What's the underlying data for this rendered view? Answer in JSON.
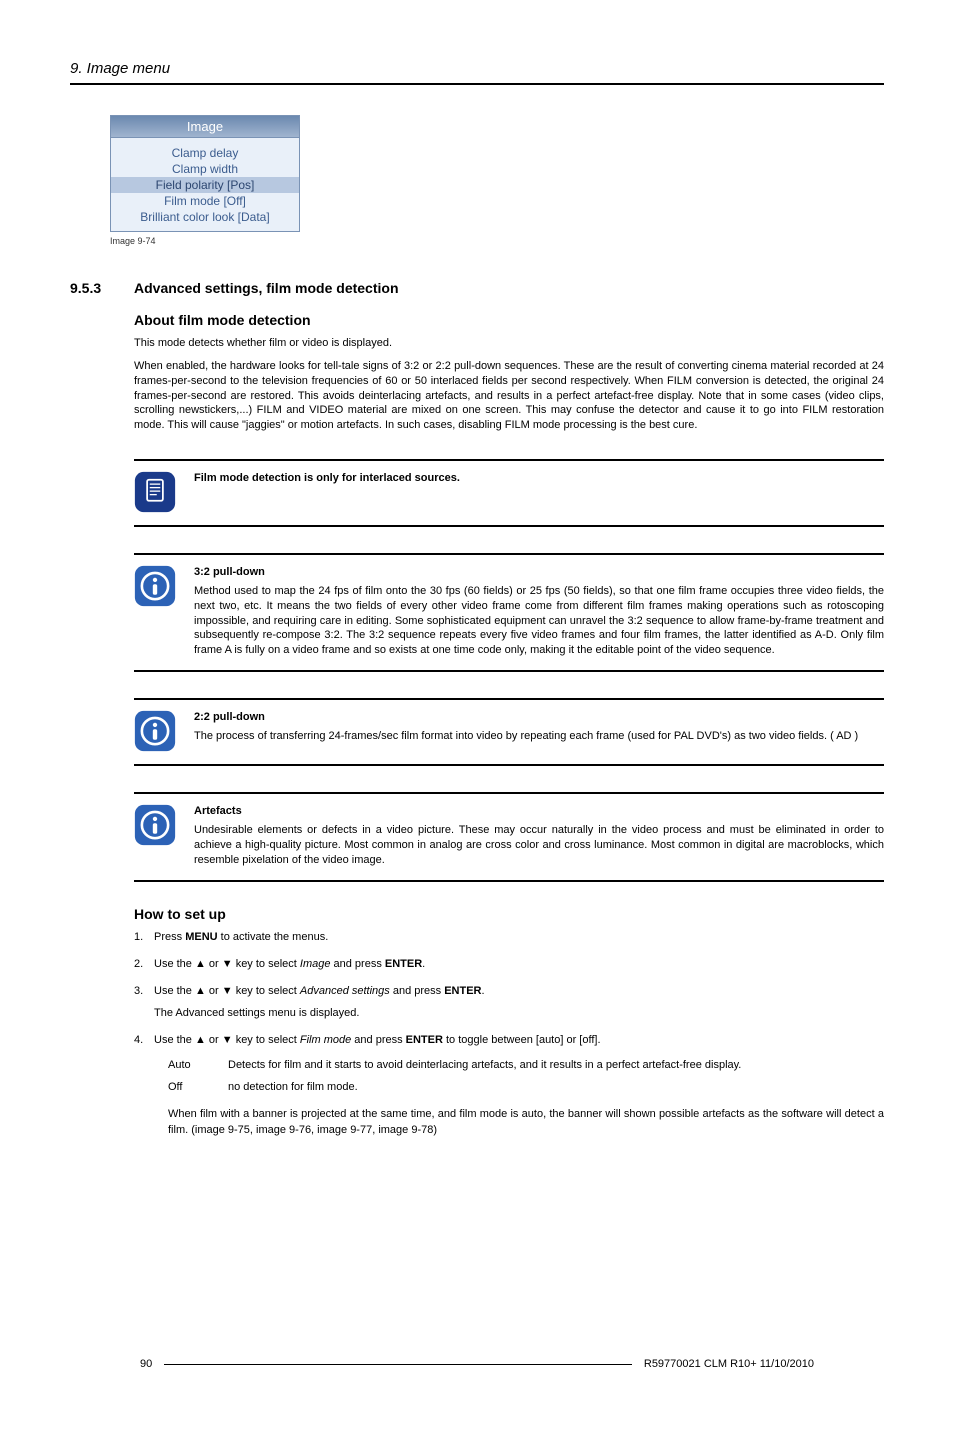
{
  "header": {
    "section_title": "9.  Image menu"
  },
  "menu": {
    "title": "Image",
    "items": [
      {
        "label": "Clamp delay",
        "selected": false
      },
      {
        "label": "Clamp width",
        "selected": false
      },
      {
        "label": "Field polarity [Pos]",
        "selected": true
      },
      {
        "label": "Film mode [Off]",
        "selected": false
      },
      {
        "label": "Brilliant color look [Data]",
        "selected": false
      }
    ],
    "caption": "Image 9-74"
  },
  "section": {
    "number": "9.5.3",
    "title": "Advanced settings, film mode detection"
  },
  "about": {
    "heading": "About film mode detection",
    "p1": "This mode detects whether film or video is displayed.",
    "p2": "When enabled, the hardware looks for tell-tale signs of 3:2 or 2:2 pull-down sequences. These are the result of converting cinema material recorded at 24 frames-per-second to the television frequencies of 60 or 50 interlaced fields per second respectively. When FILM conversion is detected, the original 24 frames-per-second are restored. This avoids deinterlacing artefacts, and results in a perfect artefact-free display. Note that in some cases (video clips, scrolling newstickers,...) FILM and VIDEO material are mixed on one screen. This may confuse the detector and cause it to go into FILM restoration mode. This will cause \"jaggies\" or motion artefacts. In such cases, disabling FILM mode processing is the best cure."
  },
  "note": {
    "text": "Film mode detection is only for interlaced sources."
  },
  "info1": {
    "title": "3:2 pull-down",
    "body": "Method used to map the 24 fps of film onto the 30 fps (60 fields) or 25 fps (50 fields), so that one film frame occupies three video fields, the next two, etc. It means the two fields of every other video frame come from different film frames making operations such as rotoscoping impossible, and requiring care in editing. Some sophisticated equipment can unravel the 3:2 sequence to allow frame-by-frame treatment and subsequently re-compose 3:2. The 3:2 sequence repeats every five video frames and four film frames, the latter identified as A-D. Only film frame A is fully on a video frame and so exists at one time code only, making it the editable point of the video sequence."
  },
  "info2": {
    "title": "2:2 pull-down",
    "body": "The process of transferring 24-frames/sec film format into video by repeating each frame (used for PAL DVD's) as two video fields. ( AD )"
  },
  "info3": {
    "title": "Artefacts",
    "body": "Undesirable elements or defects in a video picture. These may occur naturally in the video process and must be eliminated in order to achieve a high-quality picture. Most common in analog are cross color and cross luminance. Most common in digital are macroblocks, which resemble pixelation of the video image."
  },
  "howto": {
    "heading": "How to set up",
    "step1_a": "Press ",
    "step1_b": "MENU",
    "step1_c": " to activate the menus.",
    "step2_a": "Use the ▲ or ▼ key to select ",
    "step2_i": "Image",
    "step2_b": " and press ",
    "step2_bold": "ENTER",
    "step2_c": ".",
    "step3_a": "Use the ▲ or ▼ key to select ",
    "step3_i": "Advanced settings",
    "step3_b": " and press ",
    "step3_bold": "ENTER",
    "step3_c": ".",
    "step3_sub": "The Advanced settings menu is displayed.",
    "step4_a": "Use the ▲ or ▼ key to select ",
    "step4_i": "Film mode",
    "step4_b": " and press ",
    "step4_bold": "ENTER",
    "step4_c": " to toggle between [auto] or [off].",
    "defs": [
      {
        "term": "Auto",
        "desc": "Detects for film and it starts to avoid deinterlacing artefacts, and it results in a perfect artefact-free display."
      },
      {
        "term": "Off",
        "desc": "no detection for film mode."
      }
    ],
    "after_defs": "When film with a banner is projected at the same time, and film mode is auto, the banner will shown possible artefacts as the software will detect a film. (image 9-75, image 9-76, image 9-77, image 9-78)"
  },
  "footer": {
    "page": "90",
    "doc": "R59770021  CLM R10+  11/10/2010"
  }
}
